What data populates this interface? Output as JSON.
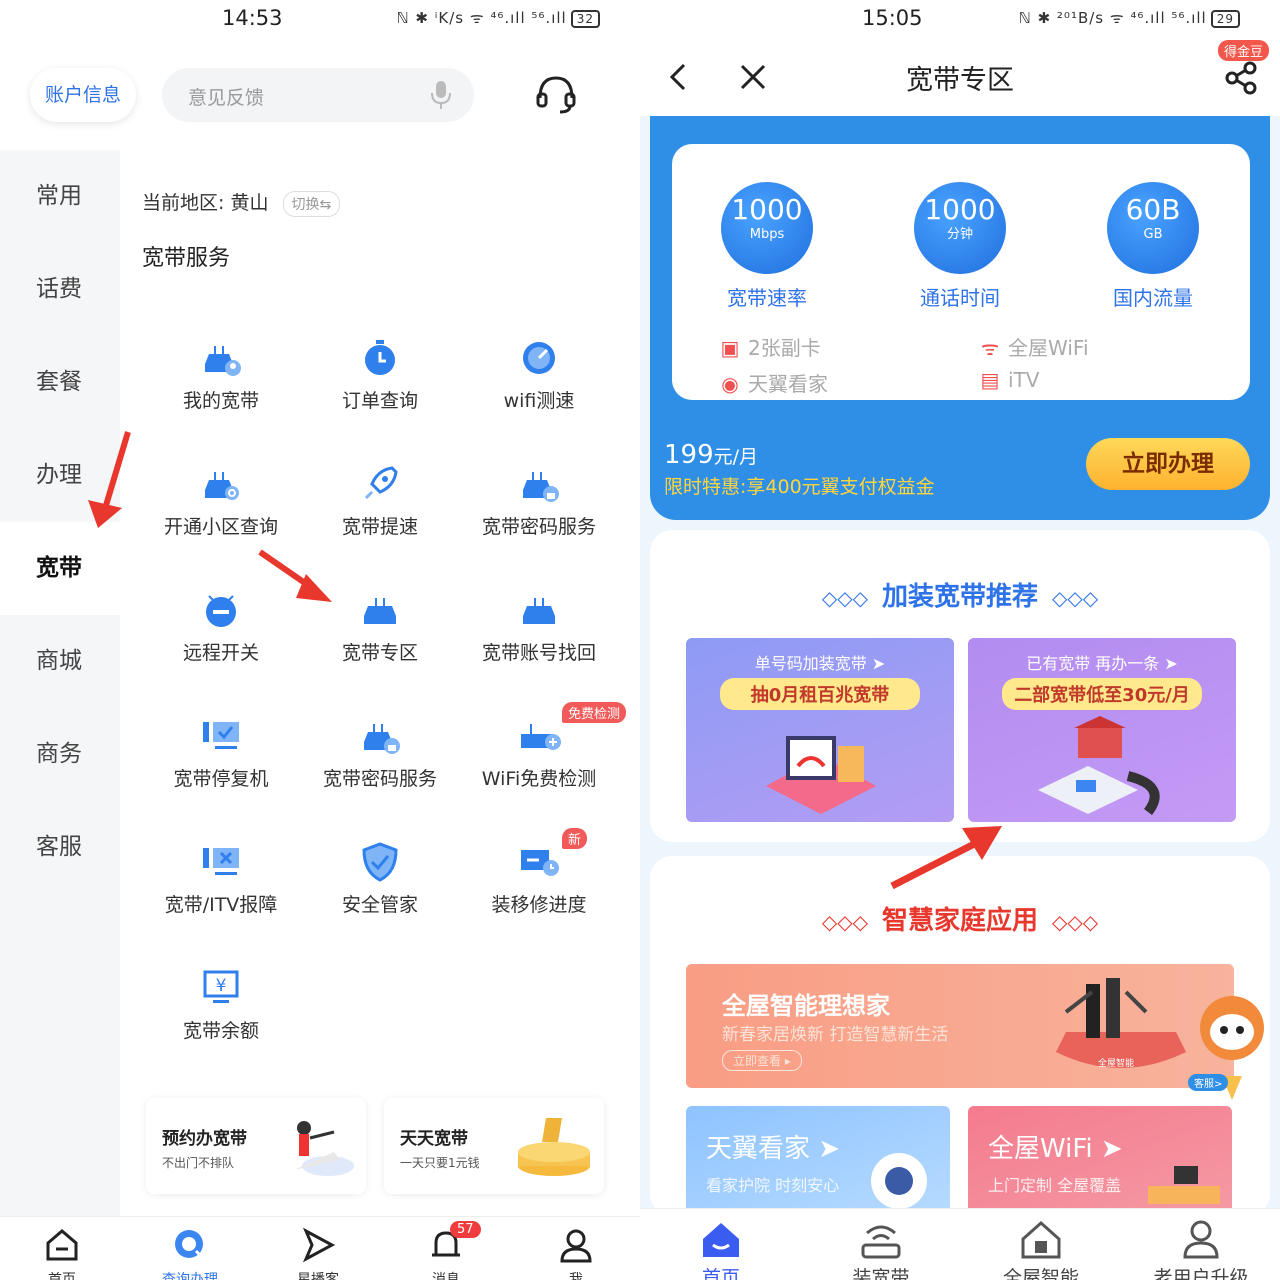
{
  "left": {
    "status": {
      "time": "14:53",
      "icons": "ℕ ✱ ⁱK/s ᯤ ⁴⁶.ıll ⁵⁶.ıll",
      "battery": "32"
    },
    "header": {
      "account_label": "账户信息",
      "search_placeholder": "意见反馈"
    },
    "sidebar": {
      "items": [
        "常用",
        "话费",
        "套餐",
        "办理",
        "宽带",
        "商城",
        "商务",
        "客服"
      ],
      "active": "宽带"
    },
    "region": {
      "label": "当前地区: 黄山",
      "switch": "切换⇆"
    },
    "section_title": "宽带服务",
    "services": [
      {
        "label": "我的宽带",
        "icon": "router-user-icon"
      },
      {
        "label": "订单查询",
        "icon": "clock-icon"
      },
      {
        "label": "wifi测速",
        "icon": "speedometer-icon"
      },
      {
        "label": "开通小区查询",
        "icon": "router-search-icon"
      },
      {
        "label": "宽带提速",
        "icon": "rocket-icon"
      },
      {
        "label": "宽带密码服务",
        "icon": "router-lock-icon"
      },
      {
        "label": "远程开关",
        "icon": "power-icon"
      },
      {
        "label": "宽带专区",
        "icon": "router-icon"
      },
      {
        "label": "宽带账号找回",
        "icon": "router-icon"
      },
      {
        "label": "宽带停复机",
        "icon": "plug-monitor-icon"
      },
      {
        "label": "宽带密码服务",
        "icon": "router-lock-icon"
      },
      {
        "label": "WiFi免费检测",
        "icon": "router-plus-icon",
        "tag": "免费检测"
      },
      {
        "label": "宽带/ITV报障",
        "icon": "plug-error-icon"
      },
      {
        "label": "安全管家",
        "icon": "shield-check-icon"
      },
      {
        "label": "装移修进度",
        "icon": "monitor-progress-icon",
        "tag": "新"
      },
      {
        "label": "宽带余额",
        "icon": "yuan-monitor-icon"
      }
    ],
    "promos": [
      {
        "title": "预约办宽带",
        "subtitle": "不出门不排队"
      },
      {
        "title": "天天宽带",
        "subtitle": "一天只要1元钱"
      }
    ],
    "nav": [
      {
        "label": "首页",
        "icon": "home-icon"
      },
      {
        "label": "查询办理",
        "icon": "search-icon"
      },
      {
        "label": "星播客",
        "icon": "play-icon"
      },
      {
        "label": "消息",
        "icon": "bell-icon",
        "badge": "57"
      },
      {
        "label": "我",
        "icon": "user-icon"
      }
    ]
  },
  "right": {
    "status": {
      "time": "15:05",
      "icons": "ℕ ✱ ²⁰¹B/s ᯤ ⁴⁶.ıll ⁵⁶.ıll",
      "battery": "29"
    },
    "header": {
      "title": "宽带专区",
      "coin_tag": "得金豆"
    },
    "hero": {
      "stats": [
        {
          "num": "1000",
          "unit": "Mbps",
          "caption": "宽带速率"
        },
        {
          "num": "1000",
          "unit": "分钟",
          "caption": "通话时间"
        },
        {
          "num": "60B",
          "unit": "GB",
          "caption": "国内流量"
        }
      ],
      "features": [
        "2张副卡",
        "全屋WiFi",
        "天翼看家",
        "iTV"
      ],
      "price": "199",
      "price_unit": "元/月",
      "offer": "限时特惠:享400元翼支付权益金",
      "cta": "立即办理"
    },
    "section1": {
      "title": "加装宽带推荐",
      "tiles": [
        {
          "line1": "单号码加装宽带 ➤",
          "line2": "抽0月租百兆宽带"
        },
        {
          "line1": "已有宽带 再办一条 ➤",
          "line2": "二部宽带低至30元/月"
        }
      ]
    },
    "section2": {
      "title": "智慧家庭应用",
      "banner": {
        "title": "全屋智能理想家",
        "subtitle": "新春家居焕新 打造智慧新生活",
        "button": "立即查看 ▸",
        "badge": "全屋智能"
      },
      "mascot_label": "客服>",
      "minis": [
        {
          "title": "天翼看家 ➤",
          "subtitle": "看家护院 时刻安心"
        },
        {
          "title": "全屋WiFi ➤",
          "subtitle": "上门定制 全屋覆盖"
        }
      ]
    },
    "nav": [
      {
        "label": "首页",
        "icon": "home-icon"
      },
      {
        "label": "装宽带",
        "icon": "router-icon"
      },
      {
        "label": "全屋智能",
        "icon": "smart-home-icon"
      },
      {
        "label": "老用户升级",
        "icon": "user-icon"
      }
    ]
  },
  "colors": {
    "accent_blue": "#2f73e8",
    "hero_blue": "#2f8ee6",
    "arrow_red": "#e8372c",
    "section_red": "#e8372c"
  }
}
